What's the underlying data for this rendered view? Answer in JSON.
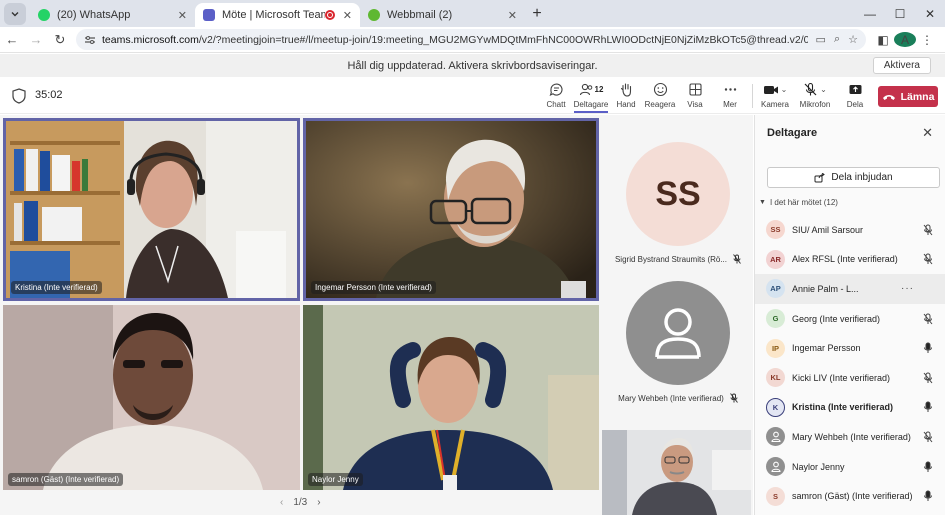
{
  "browser": {
    "tabs": [
      {
        "title": "(20) WhatsApp",
        "favicon_color": "#25d366",
        "active": false
      },
      {
        "title": "Möte | Microsoft Teams",
        "favicon_color": "#5b5fc7",
        "active": true
      },
      {
        "title": "Webbmail (2)",
        "favicon_color": "#5fb832",
        "active": false
      }
    ],
    "url_host": "teams.microsoft.com",
    "url_path": "/v2/?meetingjoin=true#/l/meetup-join/19:meeting_MGU2MGYwMDQtMmFhNC00OWRhLWI0ODctNjE0NjZiMzBkOTc5@thread.v2/0?context=%7b\"Tid\"%3a\"86932a36-37a...",
    "profile_initial": "A"
  },
  "notification": {
    "text": "Håll dig uppdaterad. Aktivera skrivbordsaviseringar.",
    "action": "Aktivera"
  },
  "toolbar": {
    "timer": "35:02",
    "buttons": [
      {
        "id": "chat",
        "label": "Chatt",
        "icon": "chat-icon"
      },
      {
        "id": "participants",
        "label": "Deltagare",
        "icon": "people-icon",
        "count": "12"
      },
      {
        "id": "hand",
        "label": "Hand",
        "icon": "hand-icon"
      },
      {
        "id": "react",
        "label": "Reagera",
        "icon": "emoji-icon"
      },
      {
        "id": "view",
        "label": "Visa",
        "icon": "grid-icon"
      },
      {
        "id": "more",
        "label": "Mer",
        "icon": "more-icon"
      },
      {
        "id": "camera",
        "label": "Kamera",
        "icon": "camera-icon"
      },
      {
        "id": "mic",
        "label": "Mikrofon",
        "icon": "mic-off-icon"
      },
      {
        "id": "share",
        "label": "Dela",
        "icon": "share-icon"
      }
    ],
    "leave_label": "Lämna"
  },
  "stage": {
    "tiles": [
      {
        "name": "Kristina (Inte verifierad)",
        "speaking": true
      },
      {
        "name": "Ingemar Persson (Inte verifierad)",
        "speaking": true
      },
      {
        "name": "samron (Gäst) (Inte verifierad)",
        "speaking": false
      },
      {
        "name": "Naylor Jenny",
        "speaking": false
      }
    ],
    "side": [
      {
        "initials": "SS",
        "name": "Sigrid Bystrand Straumits (Rö...",
        "muted": true
      },
      {
        "initials": "",
        "name": "Mary Wehbeh (Inte verifierad)",
        "muted": true
      }
    ],
    "pager": "1/3"
  },
  "panel": {
    "title": "Deltagare",
    "invite_label": "Dela inbjudan",
    "section_label": "I det här mötet (12)",
    "participants": [
      {
        "initials": "SS",
        "name": "SIU/ Amil Sarsour",
        "bg": "#f6d7cf",
        "fg": "#8a3a2a",
        "mic": "muted",
        "bold": false
      },
      {
        "initials": "AR",
        "name": "Alex RFSL (Inte verifierad)",
        "bg": "#f2d2d2",
        "fg": "#8a2a2a",
        "mic": "muted",
        "bold": false
      },
      {
        "initials": "AP",
        "name": "Annie Palm - L...",
        "bg": "#d5e3f0",
        "fg": "#2b4f78",
        "mic": "none",
        "bold": false
      },
      {
        "initials": "G",
        "name": "Georg (Inte verifierad)",
        "bg": "#d8ecd6",
        "fg": "#2d6a2a",
        "mic": "muted",
        "bold": false
      },
      {
        "initials": "IP",
        "name": "Ingemar Persson",
        "bg": "#fbe6c9",
        "fg": "#8a5a14",
        "mic": "on",
        "bold": false
      },
      {
        "initials": "KL",
        "name": "Kicki LIV (Inte verifierad)",
        "bg": "#f2d8d2",
        "fg": "#8a3a2a",
        "mic": "muted",
        "bold": false
      },
      {
        "initials": "K",
        "name": "Kristina (Inte verifierad)",
        "bg": "#e3e6f3",
        "fg": "#3a3f7a",
        "mic": "on",
        "bold": true
      },
      {
        "initials": "",
        "name": "Mary Wehbeh (Inte verifierad)",
        "bg": "#8f8f8f",
        "fg": "#ffffff",
        "mic": "muted",
        "bold": false
      },
      {
        "initials": "",
        "name": "Naylor Jenny",
        "bg": "#8f8f8f",
        "fg": "#ffffff",
        "mic": "on",
        "bold": false
      },
      {
        "initials": "S",
        "name": "samron (Gäst) (Inte verifierad)",
        "bg": "#f4ddd6",
        "fg": "#8a3a2a",
        "mic": "on",
        "bold": false
      }
    ]
  }
}
